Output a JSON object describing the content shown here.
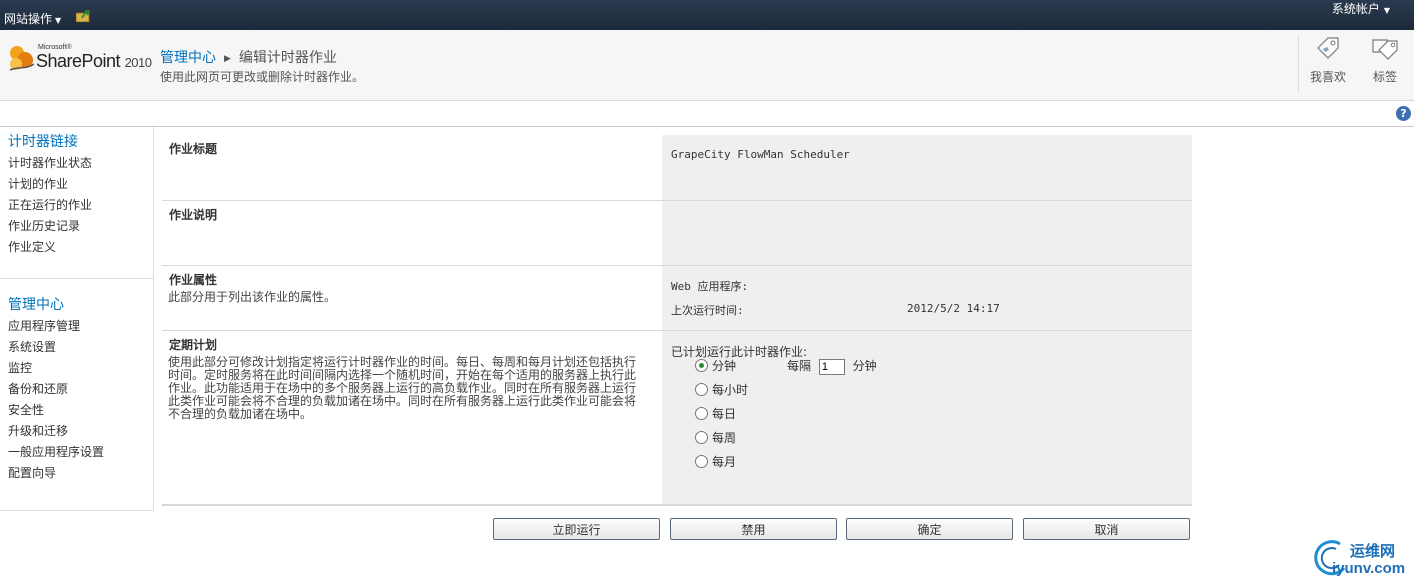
{
  "topbar": {
    "site_actions": "网站操作",
    "account": "系统帐户"
  },
  "logo": {
    "microsoft": "Microsoft®",
    "product": "SharePoint",
    "year": "2010"
  },
  "header": {
    "breadcrumb_root": "管理中心",
    "breadcrumb_current": "编辑计时器作业",
    "description": "使用此网页可更改或删除计时器作业。"
  },
  "ribbon": {
    "like": "我喜欢",
    "tags": "标签"
  },
  "help": {
    "label": "?"
  },
  "leftnav": {
    "group1": {
      "heading": "计时器链接",
      "items": [
        "计时器作业状态",
        "计划的作业",
        "正在运行的作业",
        "作业历史记录",
        "作业定义"
      ]
    },
    "group2": {
      "heading": "管理中心",
      "items": [
        "应用程序管理",
        "系统设置",
        "监控",
        "备份和还原",
        "安全性",
        "升级和迁移",
        "一般应用程序设置",
        "配置向导"
      ]
    }
  },
  "form": {
    "title_section": {
      "label": "作业标题",
      "value": "GrapeCity FlowMan Scheduler"
    },
    "desc_section": {
      "label": "作业说明",
      "value": ""
    },
    "props_section": {
      "label": "作业属性",
      "description": "此部分用于列出该作业的属性。",
      "web_app_label": "Web 应用程序:",
      "last_run_label": "上次运行时间:",
      "last_run_value": "2012/5/2 14:17"
    },
    "schedule_section": {
      "label": "定期计划",
      "description": "使用此部分可修改计划指定将运行计时器作业的时间。每日、每周和每月计划还包括执行时间。定时服务将在此时间间隔内选择一个随机时间，开始在每个适用的服务器上执行此作业。此功能适用于在场中的多个服务器上运行的高负载作业。同时在所有服务器上运行此类作业可能会将不合理的负载加诸在场中。同时在所有服务器上运行此类作业可能会将不合理的负载加诸在场中。",
      "heading": "已计划运行此计时器作业:",
      "options": [
        "分钟",
        "每小时",
        "每日",
        "每周",
        "每月"
      ],
      "selected": "分钟",
      "interval_prefix": "每隔",
      "interval_value": "1",
      "interval_unit": "分钟"
    }
  },
  "buttons": {
    "run_now": "立即运行",
    "disable": "禁用",
    "ok": "确定",
    "cancel": "取消"
  },
  "watermark": {
    "name": "运维网",
    "url": "iyunv.com"
  }
}
